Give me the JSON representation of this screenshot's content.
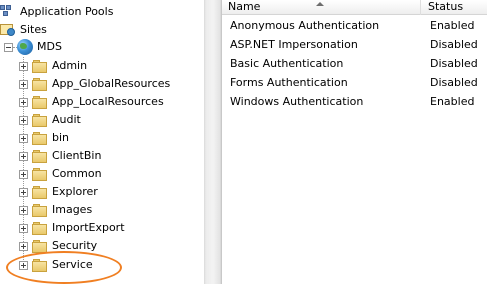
{
  "tree": {
    "items": [
      {
        "label": "Application Pools"
      },
      {
        "label": "Sites"
      },
      {
        "label": "MDS"
      },
      {
        "label": "Admin"
      },
      {
        "label": "App_GlobalResources"
      },
      {
        "label": "App_LocalResources"
      },
      {
        "label": "Audit"
      },
      {
        "label": "bin"
      },
      {
        "label": "ClientBin"
      },
      {
        "label": "Common"
      },
      {
        "label": "Explorer"
      },
      {
        "label": "Images"
      },
      {
        "label": "ImportExport"
      },
      {
        "label": "Security"
      },
      {
        "label": "Service"
      }
    ],
    "highlighted_item": "Service",
    "highlight_color": "#f07f22"
  },
  "list": {
    "columns": {
      "name": "Name",
      "status": "Status"
    },
    "sort_column": "Name",
    "rows": [
      {
        "name": "Anonymous Authentication",
        "status": "Enabled"
      },
      {
        "name": "ASP.NET Impersonation",
        "status": "Disabled"
      },
      {
        "name": "Basic Authentication",
        "status": "Disabled"
      },
      {
        "name": "Forms Authentication",
        "status": "Disabled"
      },
      {
        "name": "Windows Authentication",
        "status": "Enabled"
      }
    ]
  }
}
